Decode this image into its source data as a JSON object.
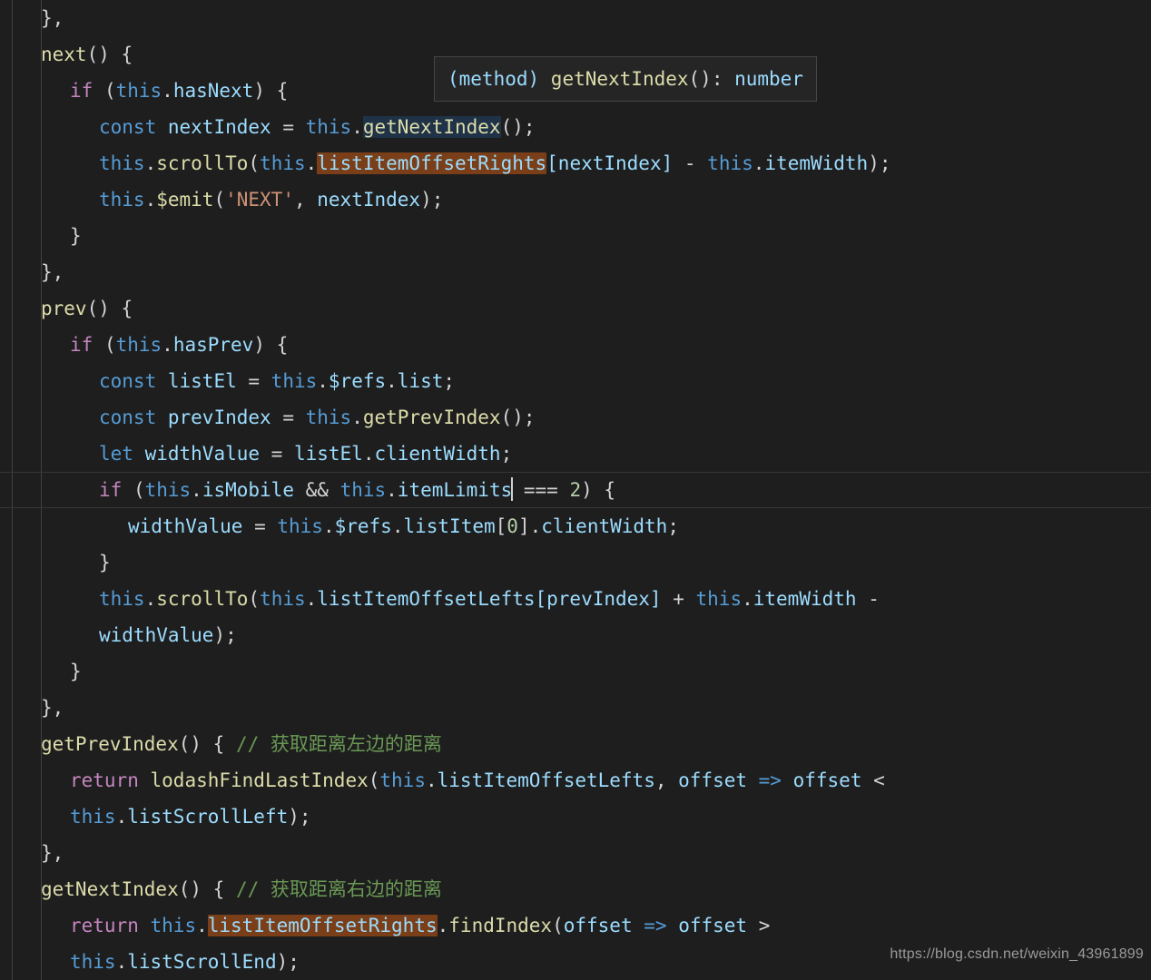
{
  "editor": {
    "app": "vscode-editor",
    "theme": "dark-plus",
    "background": "#1e1e1e",
    "foreground": "#d4d4d4",
    "font_size_px": 21,
    "line_height_px": 40,
    "indent_guide_color": "#404040",
    "current_line_border_color": "#333639",
    "search_match_color": "#7a3f18",
    "occurrence_highlight_color": "#1f3247"
  },
  "tooltip": {
    "visible": true,
    "prefix": "(method) ",
    "name": "getNextIndex",
    "parens": "()",
    "colon": ": ",
    "type": "number",
    "full_text": "(method) getNextIndex(): number",
    "background": "#252526",
    "border": "#454545"
  },
  "highlights": {
    "search_term": "listItemOffsetRights",
    "hover_token": "getNextIndex"
  },
  "caret": {
    "line_index": 13,
    "after_token": "itemLimits"
  },
  "watermark": {
    "text": "https://blog.csdn.net/weixin_43961899",
    "color": "#9a9a9a"
  },
  "code": {
    "language": "javascript",
    "lines": [
      "    },",
      "    next() {",
      "      if (this.hasNext) {",
      "        const nextIndex = this.getNextIndex();",
      "        this.scrollTo(this.listItemOffsetRights[nextIndex] - this.itemWidth);",
      "        this.$emit('NEXT', nextIndex);",
      "      }",
      "    },",
      "    prev() {",
      "      if (this.hasPrev) {",
      "        const listEl = this.$refs.list;",
      "        const prevIndex = this.getPrevIndex();",
      "        let widthValue = listEl.clientWidth;",
      "        if (this.isMobile && this.itemLimits === 2) {",
      "          widthValue = this.$refs.listItem[0].clientWidth;",
      "        }",
      "        this.scrollTo(this.listItemOffsetLefts[prevIndex] + this.itemWidth - widthValue);",
      "      }",
      "    },",
      "    getPrevIndex() { // 获取距离左边的距离",
      "      return lodashFindLastIndex(this.listItemOffsetLefts, offset => offset < this.listScrollLeft);",
      "    },",
      "    getNextIndex() { // 获取距离右边的距离",
      "      return this.listItemOffsetRights.findIndex(offset => offset > this.listScrollEnd);"
    ],
    "comments": [
      "// 获取距离左边的距离",
      "// 获取距离右边的距离"
    ],
    "identifiers": [
      "next",
      "prev",
      "hasNext",
      "hasPrev",
      "nextIndex",
      "prevIndex",
      "listEl",
      "widthValue",
      "isMobile",
      "itemLimits",
      "itemWidth",
      "listItemOffsetRights",
      "listItemOffsetLefts",
      "listScrollLeft",
      "listScrollEnd",
      "getNextIndex",
      "getPrevIndex",
      "scrollTo",
      "$emit",
      "$refs",
      "list",
      "listItem",
      "clientWidth",
      "lodashFindLastIndex",
      "findIndex",
      "offset"
    ],
    "strings": [
      "'NEXT'"
    ],
    "numbers": [
      "0",
      "2"
    ]
  }
}
